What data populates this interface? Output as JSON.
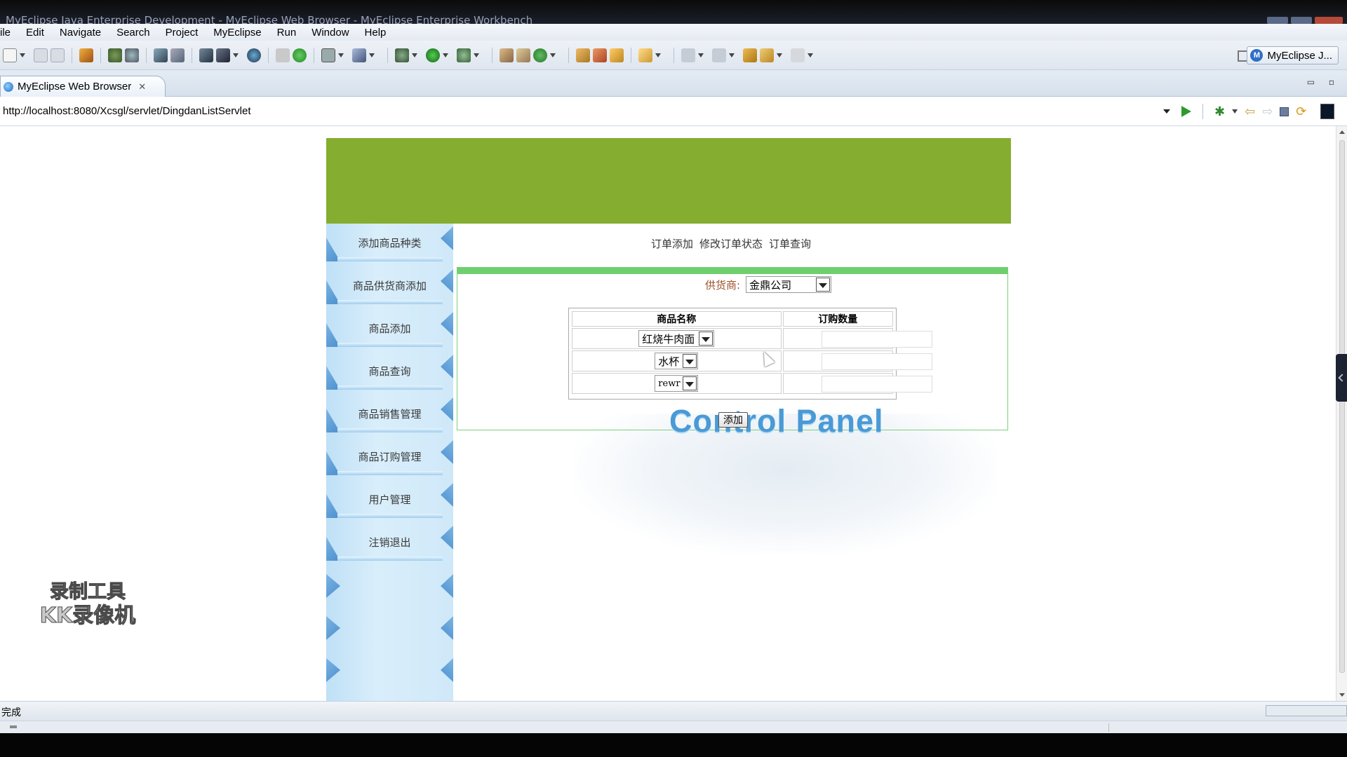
{
  "window": {
    "title": "MyEclipse Java Enterprise Development - MyEclipse Web Browser - MyEclipse Enterprise Workbench"
  },
  "menu": [
    "ile",
    "Edit",
    "Navigate",
    "Search",
    "Project",
    "MyEclipse",
    "Run",
    "Window",
    "Help"
  ],
  "toolbar": {
    "perspective_label": "MyEclipse J...",
    "perspective_icon": "M"
  },
  "editor_tab": {
    "label": "MyEclipse Web Browser",
    "close_glyph": "✕"
  },
  "address": {
    "url": "http://localhost:8080/Xcsgl/servlet/DingdanListServlet"
  },
  "page": {
    "nav_items": [
      "添加商品种类",
      "商品供货商添加",
      "商品添加",
      "商品查询",
      "商品销售管理",
      "商品订购管理",
      "用户管理",
      "注销退出"
    ],
    "top_links": [
      "订单添加",
      "修改订单状态",
      "订单查询"
    ],
    "supplier_label": "供货商:",
    "supplier_value": "金鼎公司",
    "table": {
      "headers": [
        "商品名称",
        "订购数量"
      ],
      "rows": [
        {
          "product": "红烧牛肉面",
          "qty": ""
        },
        {
          "product": "水杯",
          "qty": ""
        },
        {
          "product": "rewr",
          "qty": ""
        }
      ]
    },
    "add_button": "添加",
    "watermark": "Control Panel"
  },
  "status": {
    "text": "完成"
  },
  "overlay": {
    "recorder_line1": "录制工具",
    "recorder_line2": "KK录像机"
  },
  "colors": {
    "header_green": "#85ad2f",
    "panel_border": "#6fcf6f",
    "nav_blue": "#bfe0f6",
    "supplier_label": "#a0522d",
    "watermark": "#4a9ad6"
  }
}
